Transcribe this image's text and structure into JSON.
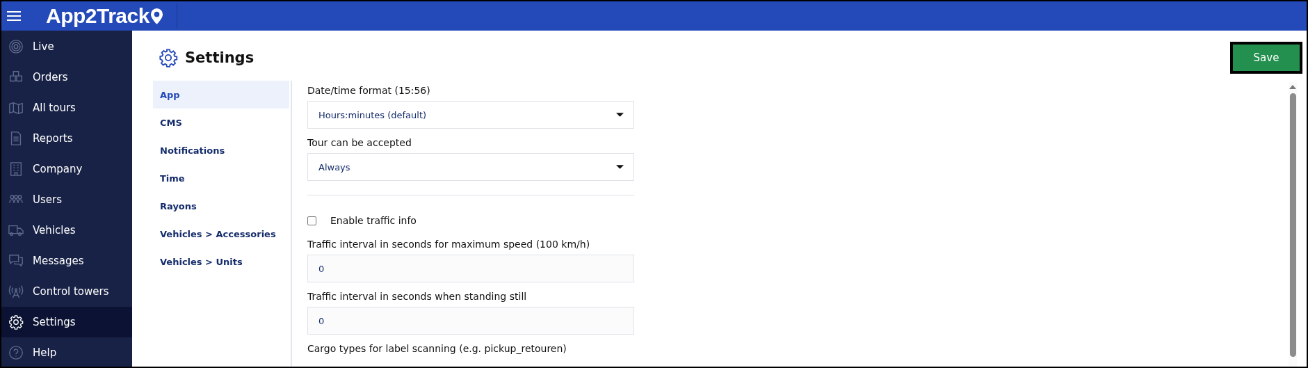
{
  "header": {
    "logo": "App2Track"
  },
  "sidebar": {
    "items": [
      {
        "label": "Live",
        "selected": false
      },
      {
        "label": "Orders",
        "selected": false
      },
      {
        "label": "All tours",
        "selected": false
      },
      {
        "label": "Reports",
        "selected": false
      },
      {
        "label": "Company",
        "selected": false
      },
      {
        "label": "Users",
        "selected": false
      },
      {
        "label": "Vehicles",
        "selected": false
      },
      {
        "label": "Messages",
        "selected": false
      },
      {
        "label": "Control towers",
        "selected": false
      },
      {
        "label": "Settings",
        "selected": true
      },
      {
        "label": "Help",
        "selected": false
      }
    ]
  },
  "page": {
    "title": "Settings",
    "save_button": "Save"
  },
  "settings_menu": [
    {
      "label": "App",
      "selected": true
    },
    {
      "label": "CMS",
      "selected": false
    },
    {
      "label": "Notifications",
      "selected": false
    },
    {
      "label": "Time",
      "selected": false
    },
    {
      "label": "Rayons",
      "selected": false
    },
    {
      "label": "Vehicles > Accessories",
      "selected": false
    },
    {
      "label": "Vehicles > Units",
      "selected": false
    }
  ],
  "form": [
    {
      "kind": "select",
      "label": "Date/time format (15:56)",
      "value": "Hours:minutes (default)"
    },
    {
      "kind": "select",
      "label": "Tour can be accepted",
      "value": "Always"
    },
    {
      "kind": "checkbox",
      "label": "Enable traffic info",
      "checked": false
    },
    {
      "kind": "text",
      "label": "Traffic interval in seconds for maximum speed (100 km/h)",
      "value": "0"
    },
    {
      "kind": "text",
      "label": "Traffic interval in seconds when standing still",
      "value": "0"
    },
    {
      "kind": "label",
      "label": "Cargo types for label scanning (e.g. pickup_retouren)"
    }
  ]
}
